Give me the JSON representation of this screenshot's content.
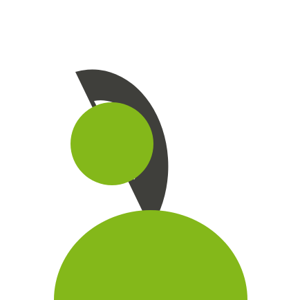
{
  "logo": {
    "mark_icon": "abstract-person-logo-icon",
    "colors": {
      "background": "#ffffff",
      "dark_arc": "#3f3f3b",
      "inner_ring": "#ffffff",
      "accent_green": "#84b81a"
    }
  }
}
